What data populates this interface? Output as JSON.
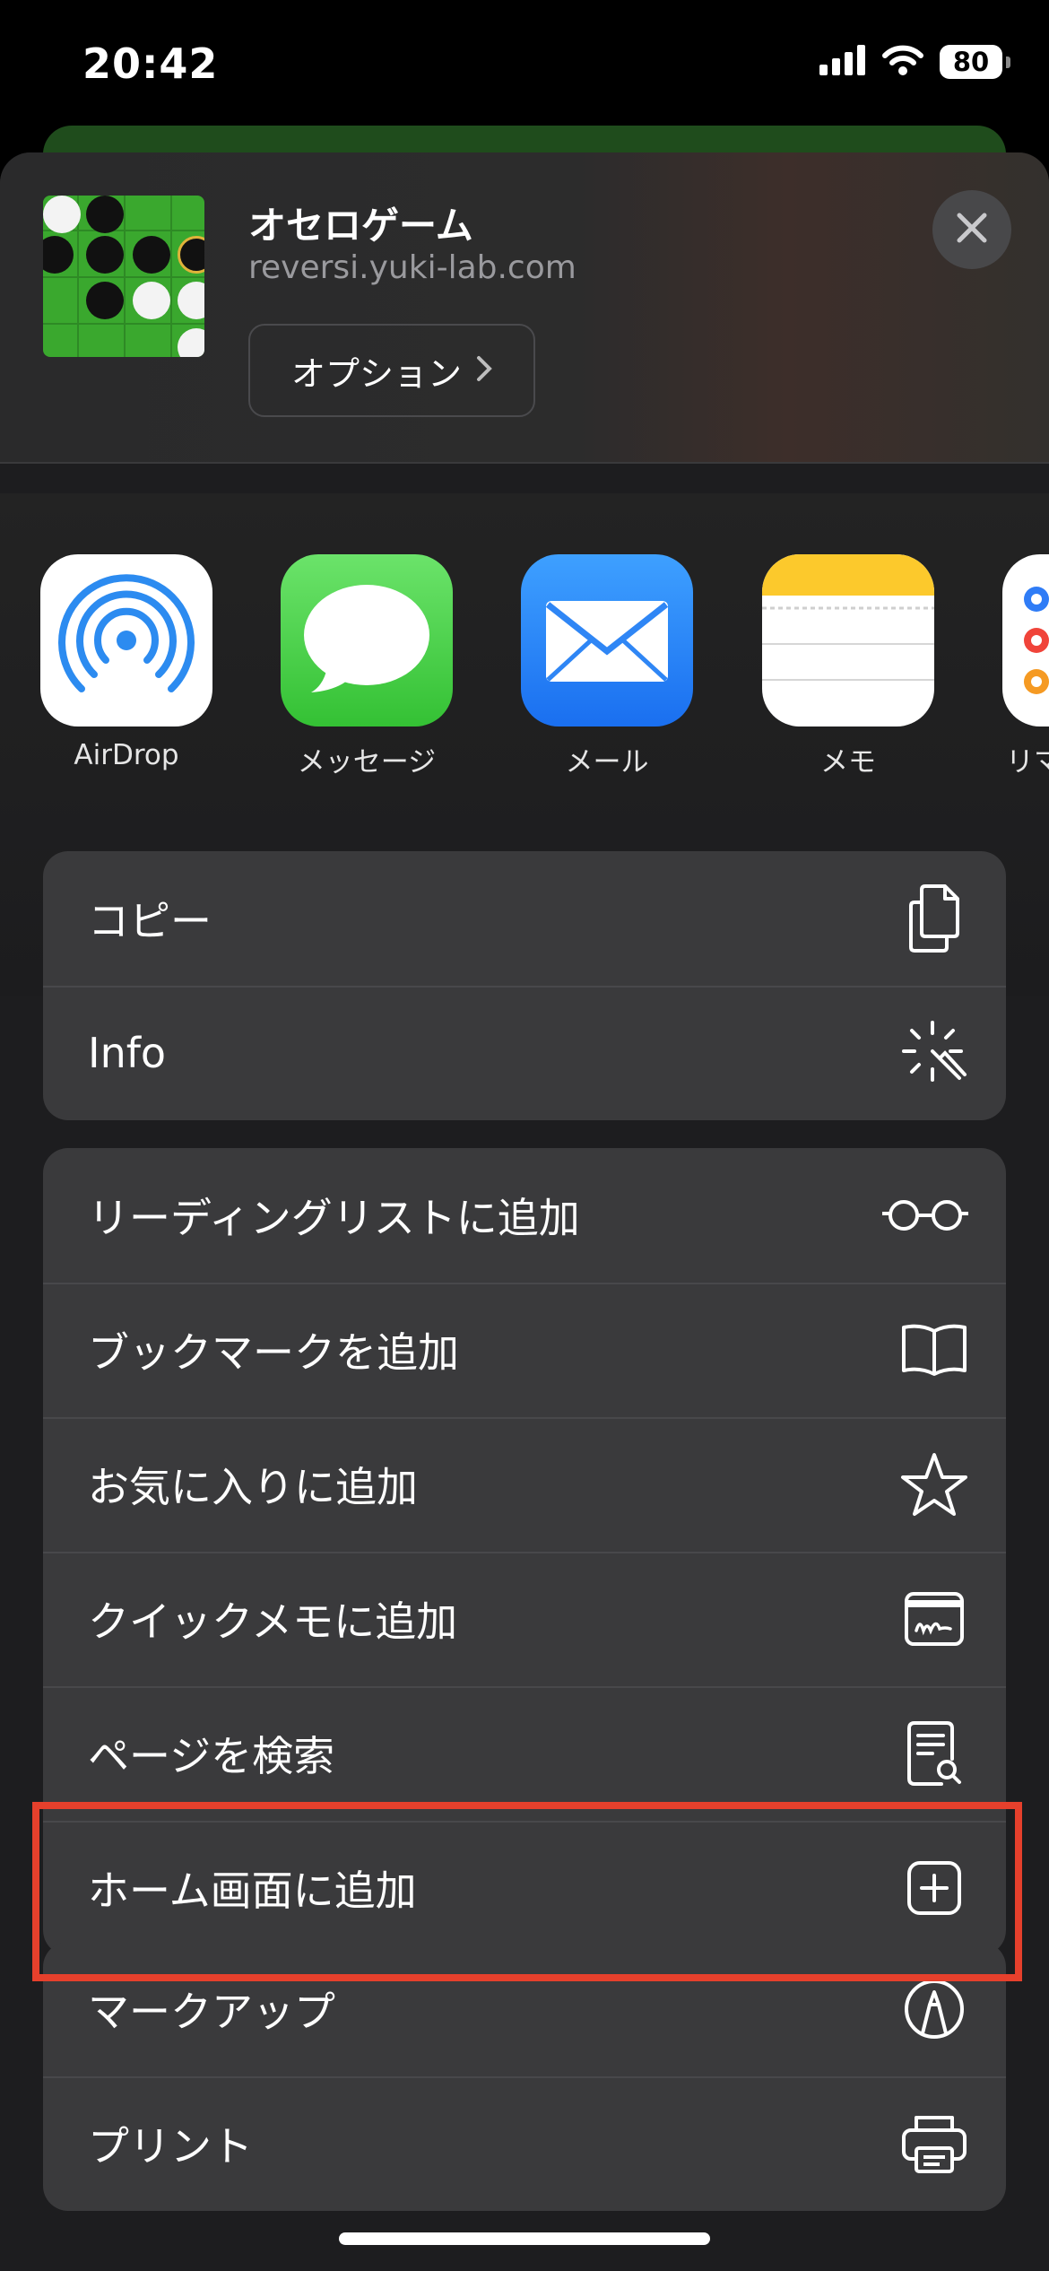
{
  "status_bar": {
    "time": "20:42",
    "battery": "80"
  },
  "header": {
    "title": "オセロゲーム",
    "domain": "reversi.yuki-lab.com",
    "options_label": "オプション"
  },
  "apps": [
    {
      "label": "AirDrop",
      "icon": "airdrop-icon"
    },
    {
      "label": "メッセージ",
      "icon": "messages-icon"
    },
    {
      "label": "メール",
      "icon": "mail-icon"
    },
    {
      "label": "メモ",
      "icon": "notes-icon"
    },
    {
      "label": "リマ",
      "icon": "reminders-icon"
    }
  ],
  "group1": [
    {
      "label": "コピー",
      "icon": "copy-icon"
    },
    {
      "label": "Info",
      "icon": "magic-wand-icon"
    }
  ],
  "group2": [
    {
      "label": "リーディングリストに追加",
      "icon": "glasses-icon"
    },
    {
      "label": "ブックマークを追加",
      "icon": "book-icon"
    },
    {
      "label": "お気に入りに追加",
      "icon": "star-icon"
    },
    {
      "label": "クイックメモに追加",
      "icon": "quick-note-icon"
    },
    {
      "label": "ページを検索",
      "icon": "find-in-page-icon"
    },
    {
      "label": "ホーム画面に追加",
      "icon": "add-square-icon"
    }
  ],
  "group3": [
    {
      "label": "マークアップ",
      "icon": "markup-icon"
    },
    {
      "label": "プリント",
      "icon": "printer-icon"
    }
  ],
  "colors": {
    "highlight": "#e6402c",
    "sheet_bg": "#1d1d1f",
    "cell_bg": "#3a3a3c"
  }
}
